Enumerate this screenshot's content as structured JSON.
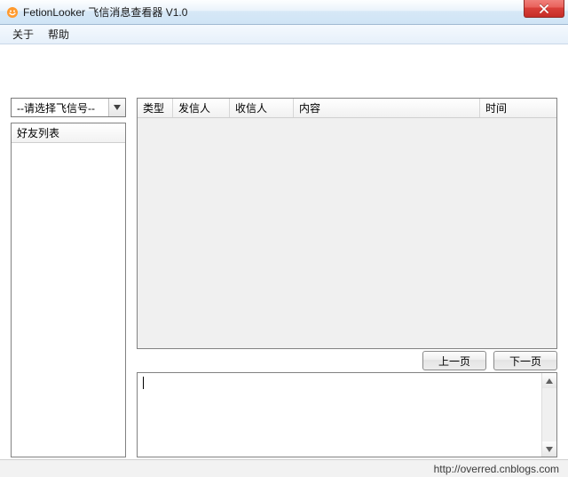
{
  "window": {
    "title": "FetionLooker 飞信消息查看器 V1.0"
  },
  "menu": {
    "about": "关于",
    "help": "帮助"
  },
  "sidebar": {
    "select_placeholder": "--请选择飞信号--",
    "friend_list_header": "好友列表"
  },
  "list": {
    "columns": {
      "type": "类型",
      "sender": "发信人",
      "receiver": "收信人",
      "content": "内容",
      "time": "时间"
    },
    "rows": []
  },
  "pager": {
    "prev": "上一页",
    "next": "下一页"
  },
  "detail": {
    "text": ""
  },
  "status": {
    "url": "http://overred.cnblogs.com"
  }
}
